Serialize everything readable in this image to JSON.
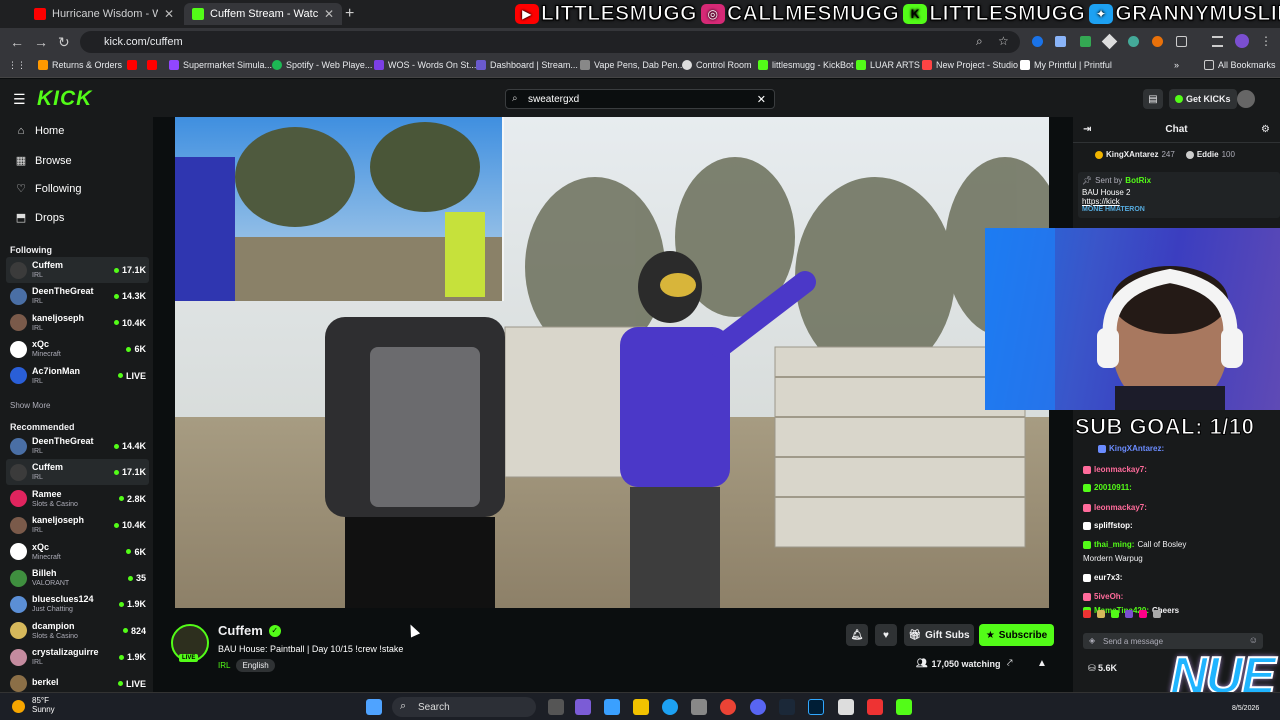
{
  "browser": {
    "tabs": [
      {
        "label": "Hurricane Wisdom - Woosah (O",
        "color": "#ff0000"
      },
      {
        "label": "Cuffem Stream - Watch Live",
        "color": "#53fc18"
      }
    ],
    "url": "kick.com/cuffem",
    "bookmarks": [
      {
        "label": "Returns & Orders",
        "color": "#ff9900"
      },
      {
        "label": "Supermarket Simula...",
        "color": "#9146ff"
      },
      {
        "label": "Spotify - Web Playe...",
        "color": "#1db954"
      },
      {
        "label": "WOS - Words On St...",
        "color": "#7b3fe4"
      },
      {
        "label": "Dashboard | Stream...",
        "color": "#6a5acd"
      },
      {
        "label": "Vape Pens, Dab Pen...",
        "color": "#888888"
      },
      {
        "label": "Control Room",
        "color": "#dddddd"
      },
      {
        "label": "littlesmugg - KickBot",
        "color": "#53fc18"
      },
      {
        "label": "LUAR ARTS",
        "color": "#53fc18"
      },
      {
        "label": "New Project - Studio",
        "color": "#ff4444"
      },
      {
        "label": "My Printful | Printful",
        "color": "#ffffff"
      },
      {
        "label": "All Bookmarks",
        "color": "#cccccc"
      }
    ]
  },
  "overlay_banner": [
    {
      "label": "LITTLESMUGG",
      "icon": "youtube-icon",
      "color": "#ff0000"
    },
    {
      "label": "CALLMESMUGG",
      "icon": "instagram-icon",
      "color": "#d62976"
    },
    {
      "label": "LITTLESMUGG",
      "icon": "kick-icon",
      "color": "#53fc18"
    },
    {
      "label": "GRANNYMUSLIM",
      "icon": "twitter-icon",
      "color": "#1da1f2"
    }
  ],
  "header": {
    "logo": "KICK",
    "search_value": "sweatergxd",
    "get_kicks": "Get KICKs"
  },
  "sidebar": {
    "nav": [
      "Home",
      "Browse",
      "Following",
      "Drops"
    ],
    "following_title": "Following",
    "following": [
      {
        "name": "Cuffem",
        "category": "IRL",
        "viewers": "17.1K",
        "color": "#3b3b3b"
      },
      {
        "name": "DeenTheGreat",
        "category": "IRL",
        "viewers": "14.3K",
        "color": "#4a6fa5"
      },
      {
        "name": "kaneljoseph",
        "category": "IRL",
        "viewers": "10.4K",
        "color": "#7a5a4a"
      },
      {
        "name": "xQc",
        "category": "Minecraft",
        "viewers": "6K",
        "color": "#ffffff"
      },
      {
        "name": "Ac7ionMan",
        "category": "IRL",
        "viewers": "LIVE",
        "color": "#2a5fd8"
      }
    ],
    "show_more": "Show More",
    "recommended_title": "Recommended",
    "recommended": [
      {
        "name": "DeenTheGreat",
        "category": "IRL",
        "viewers": "14.4K",
        "color": "#4a6fa5"
      },
      {
        "name": "Cuffem",
        "category": "IRL",
        "viewers": "17.1K",
        "color": "#3b3b3b"
      },
      {
        "name": "Ramee",
        "category": "Slots & Casino",
        "viewers": "2.8K",
        "color": "#e0245e"
      },
      {
        "name": "kaneljoseph",
        "category": "IRL",
        "viewers": "10.4K",
        "color": "#7a5a4a"
      },
      {
        "name": "xQc",
        "category": "Minecraft",
        "viewers": "6K",
        "color": "#ffffff"
      },
      {
        "name": "Billeh",
        "category": "VALORANT",
        "viewers": "35",
        "color": "#3f8f3f"
      },
      {
        "name": "bluesclues124",
        "category": "Just Chatting",
        "viewers": "1.9K",
        "color": "#5b8fd6"
      },
      {
        "name": "dcampion",
        "category": "Slots & Casino",
        "viewers": "824",
        "color": "#d6b85b"
      },
      {
        "name": "crystalizaguirre",
        "category": "IRL",
        "viewers": "1.9K",
        "color": "#c48b9f"
      },
      {
        "name": "berkel",
        "category": "",
        "viewers": "LIVE",
        "color": "#8b6f47"
      }
    ]
  },
  "stream": {
    "streamer": "Cuffem",
    "title": "BAU House: Paintball | Day 10/15  !crew !stake",
    "category": "IRL",
    "language": "English",
    "live_badge": "LIVE",
    "gift_subs": "Gift Subs",
    "subscribe": "Subscribe",
    "watching": "17,050 watching"
  },
  "chat": {
    "title": "Chat",
    "top_gifters": [
      {
        "name": "KingXAntarez",
        "count": "247"
      },
      {
        "name": "Eddie",
        "count": "100"
      }
    ],
    "pinned_by": "Sent by",
    "pinned_user": "BotRix",
    "pinned_text": "BAU House 2",
    "pinned_link": "https://kick",
    "pinned_extra": "MONE HMATERON",
    "sub_goal": "SUB GOAL: 1/10",
    "messages": [
      {
        "user": "KingXAntarez:",
        "text": "",
        "color": "#6b8cff"
      },
      {
        "user": "leonmackay7:",
        "text": "",
        "color": "#ff6b9b"
      },
      {
        "user": "20010911:",
        "text": "",
        "color": "#53fc18"
      },
      {
        "user": "leonmackay7:",
        "text": "",
        "color": "#ff6b9b"
      },
      {
        "user": "spliffstop:",
        "text": "",
        "color": "#ffffff"
      },
      {
        "user": "thai_ming:",
        "text": "Call of Bosley",
        "color": "#53fc18"
      },
      {
        "user": "",
        "text": "Mordern Warpug",
        "color": "#ffffff"
      },
      {
        "user": "eur7x3:",
        "text": "",
        "color": "#ffffff"
      },
      {
        "user": "5iveOh:",
        "text": "",
        "color": "#ff6b9b"
      },
      {
        "user": "MamaTina420:",
        "text": "Cheers",
        "color": "#53fc18"
      }
    ],
    "input_placeholder": "Send a message",
    "kicks_balance": "5.6K"
  },
  "overlay_logo": "NUE",
  "taskbar": {
    "temp": "85°F",
    "condition": "Sunny",
    "search": "Search",
    "date": "8/5/2026"
  }
}
